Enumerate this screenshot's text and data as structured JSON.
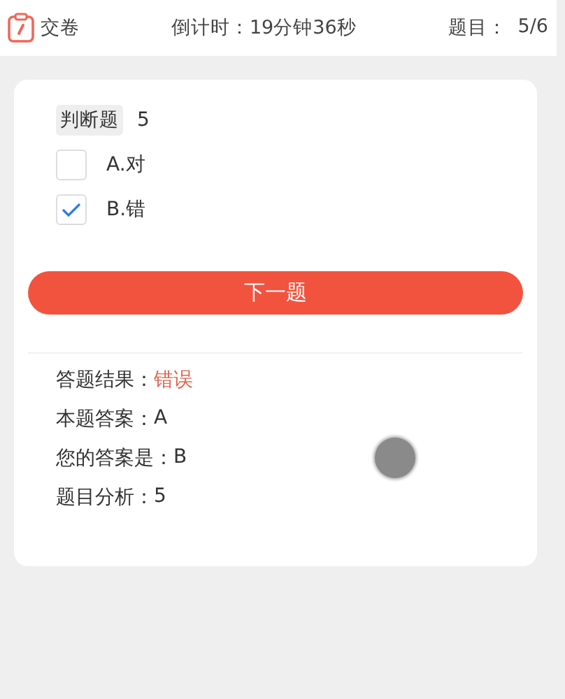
{
  "header": {
    "submit_label": "交卷",
    "countdown": "倒计时：19分钟36秒",
    "progress_label": "题目：",
    "progress": "5/6"
  },
  "question": {
    "type_tag": "判断题",
    "text": "5",
    "options": [
      {
        "label": "A.对",
        "checked": false
      },
      {
        "label": "B.错",
        "checked": true
      }
    ]
  },
  "next_button": "下一题",
  "result": {
    "label": "答题结果：",
    "value": "错误",
    "correct": false
  },
  "details": [
    {
      "label": "本题答案：",
      "value": "A"
    },
    {
      "label": "您的答案是：",
      "value": "B"
    },
    {
      "label": "题目分析：",
      "value": "5"
    }
  ]
}
